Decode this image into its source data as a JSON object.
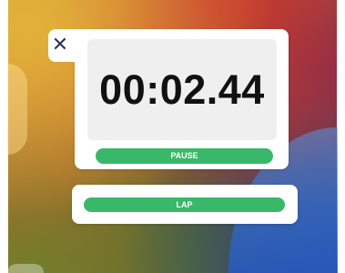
{
  "stopwatch": {
    "close_icon": "close-icon",
    "close_glyph": "✕",
    "time": "00:02.44",
    "pause_label": "PAUSE",
    "lap_label": "LAP"
  },
  "colors": {
    "accent": "#39b86a",
    "close_icon": "#2d3560",
    "card": "#ffffff",
    "display_panel": "#efefef"
  }
}
